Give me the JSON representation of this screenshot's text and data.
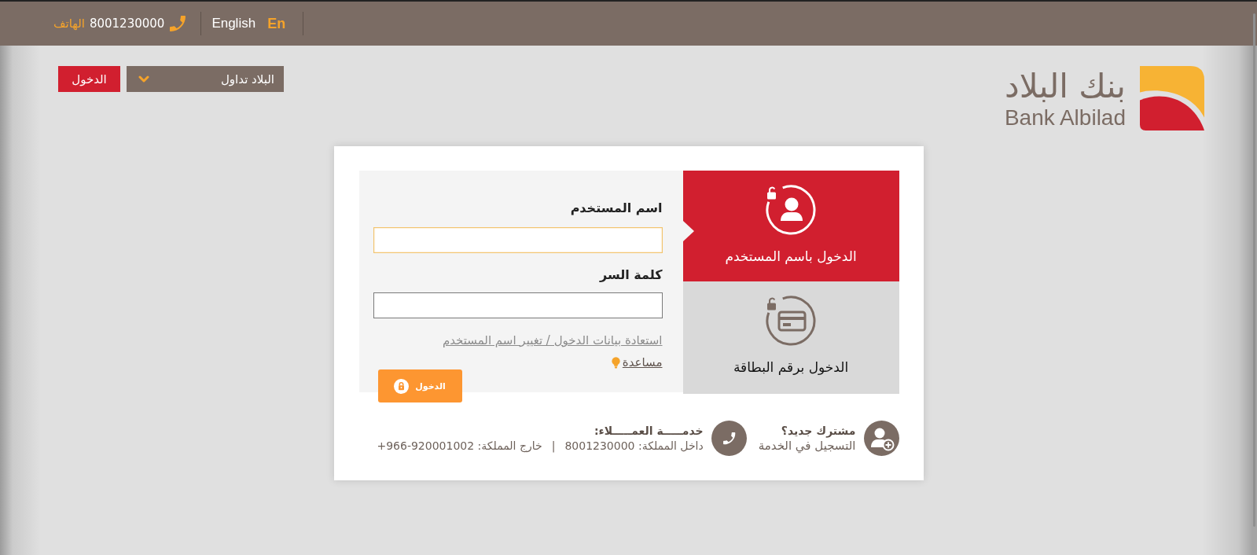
{
  "top_bar": {
    "phone_label": "الهاتف",
    "phone_number": "8001230000",
    "language_name": "English",
    "language_code": "En"
  },
  "header": {
    "login_button": "الدخول",
    "trading_select": {
      "value": "البلاد تداول"
    },
    "logo": {
      "arabic_name": "بنك البلاد",
      "english_name": "Bank Albilad"
    }
  },
  "login_card": {
    "form": {
      "fields": [
        {
          "label": "اسم المستخدم",
          "focused": true
        },
        {
          "label": "كلمة السر",
          "focused": false
        }
      ],
      "recovery_link": "استعادة بيانات الدخول / تغيير اسم المستخدم",
      "help_link": "مساعدة",
      "submit_button": "الدخول"
    },
    "login_methods": [
      {
        "kind": "username",
        "label": "الدخول باسم المستخدم",
        "selected": true
      },
      {
        "kind": "card",
        "label": "الدخول برقم البطاقة",
        "selected": false
      }
    ],
    "footer": {
      "new_subscriber": {
        "title": "مشترك جديد؟",
        "link": "التسجيل في الخدمة"
      },
      "customer_service": {
        "title": "خدمـــــة العمـــــلاء:",
        "phones": [
          {
            "label": "داخل المملكة:",
            "number": "8001230000"
          },
          {
            "label": "خارج المملكة:",
            "number": "+966-920001002"
          }
        ],
        "separator": "|"
      }
    }
  }
}
